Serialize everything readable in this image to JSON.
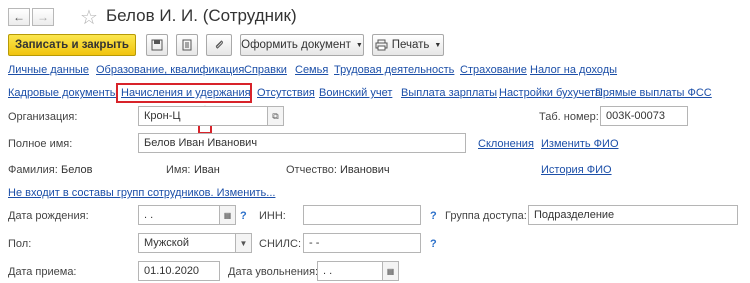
{
  "title": "Белов И. И. (Сотрудник)",
  "nav": {
    "back_icon": "arrow-left-icon",
    "forward_icon": "arrow-right-icon",
    "star_icon": "star-icon"
  },
  "toolbar": {
    "save_close": "Записать и закрыть",
    "create_doc": "Оформить документ",
    "print": "Печать"
  },
  "links_row1": [
    "Личные данные",
    "Образование, квалификация",
    "Справки",
    "Семья",
    "Трудовая деятельность",
    "Страхование",
    "Налог на доходы"
  ],
  "links_row2": [
    "Кадровые документы",
    "Начисления и удержания",
    "Отсутствия",
    "Воинский учет",
    "Выплата зарплаты",
    "Настройки бухучета",
    "Прямые выплаты ФСС"
  ],
  "form": {
    "org_label": "Организация:",
    "org_value": "Крон-Ц",
    "tab_label": "Таб. номер:",
    "tab_value": "003К-00073",
    "fullname_label": "Полное имя:",
    "fullname_value": "Белов Иван Иванович",
    "declension_link": "Склонения",
    "change_fio_link": "Изменить ФИО",
    "surname_label": "Фамилия:",
    "surname_value": "Белов",
    "name_label": "Имя:",
    "name_value": "Иван",
    "patronymic_label": "Отчество:",
    "patronymic_value": "Иванович",
    "history_fio_link": "История ФИО",
    "groups_link": "Не входит в составы групп сотрудников. Изменить...",
    "birth_label": "Дата рождения:",
    "birth_value": " .  .",
    "inn_label": "ИНН:",
    "inn_value": "",
    "access_label": "Группа доступа:",
    "access_value": "Подразделение",
    "gender_label": "Пол:",
    "gender_value": "Мужской",
    "snils_label": "СНИЛС:",
    "snils_value": "-   -",
    "hire_label": "Дата приема:",
    "hire_value": "01.10.2020",
    "fire_label": "Дата увольнения:",
    "fire_value": " .  .",
    "question": "?"
  },
  "colors": {
    "accent_link": "#1c4fa8",
    "primary_button": "#f1c40f",
    "highlight": "#d8232a"
  }
}
